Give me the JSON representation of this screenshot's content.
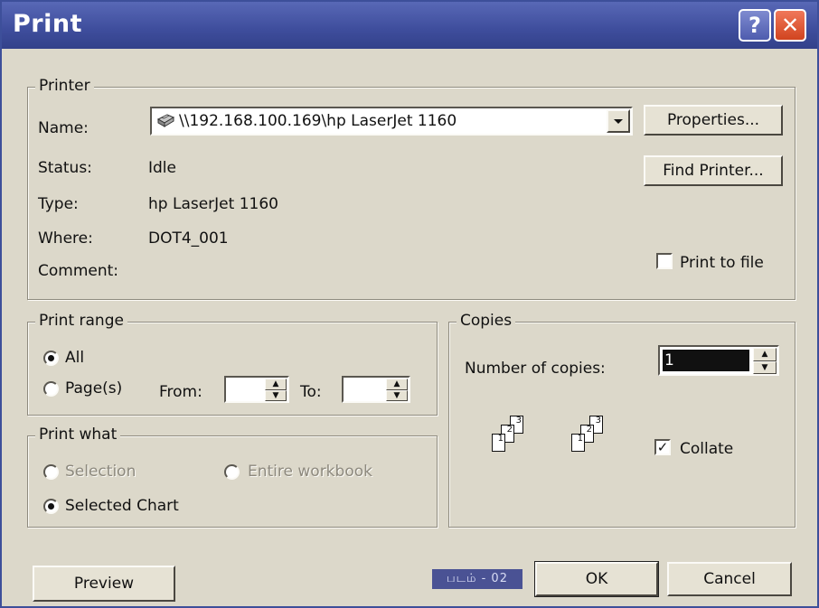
{
  "window": {
    "title": "Print",
    "help_glyph": "?",
    "close_glyph": "✕"
  },
  "printer": {
    "legend": "Printer",
    "name_label": "Name:",
    "name_value": "\\\\192.168.100.169\\hp LaserJet 1160",
    "status_label": "Status:",
    "status_value": "Idle",
    "type_label": "Type:",
    "type_value": "hp LaserJet 1160",
    "where_label": "Where:",
    "where_value": "DOT4_001",
    "comment_label": "Comment:",
    "properties_button": "Properties...",
    "find_printer_button": "Find Printer...",
    "print_to_file_label": "Print to file",
    "print_to_file_checked": false
  },
  "print_range": {
    "legend": "Print range",
    "all_label": "All",
    "pages_label": "Page(s)",
    "from_label": "From:",
    "to_label": "To:",
    "from_value": "",
    "to_value": "",
    "selected": "All"
  },
  "print_what": {
    "legend": "Print what",
    "selection_label": "Selection",
    "entire_workbook_label": "Entire workbook",
    "selected_chart_label": "Selected Chart",
    "selected": "Selected Chart"
  },
  "copies": {
    "legend": "Copies",
    "number_label": "Number of copies:",
    "number_value": "1",
    "collate_label": "Collate",
    "collate_checked": true,
    "collate_check_glyph": "✓"
  },
  "footer": {
    "preview_button": "Preview",
    "ok_button": "OK",
    "cancel_button": "Cancel",
    "badge": "படம் - 02"
  },
  "colors": {
    "title_bar": "#3e4d9c",
    "dialog_face": "#dcd8ca",
    "close_button": "#d1441f",
    "spin_highlight": "#111111"
  }
}
